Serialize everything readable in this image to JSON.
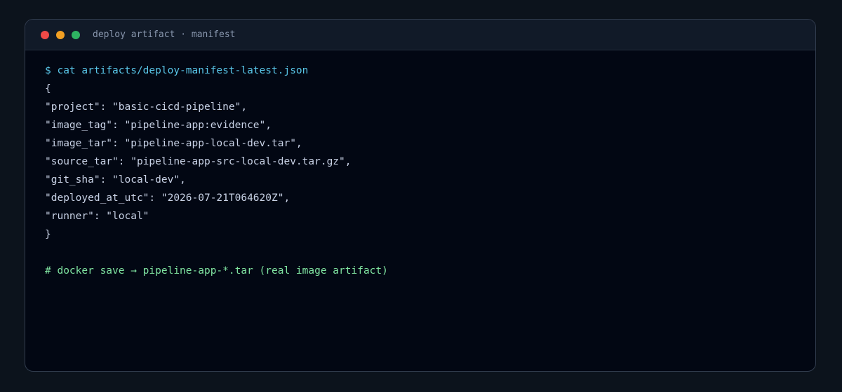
{
  "window": {
    "title": "deploy artifact · manifest",
    "controls": [
      {
        "name": "close",
        "color": "#ef4a47"
      },
      {
        "name": "minimize",
        "color": "#f2a023"
      },
      {
        "name": "maximize",
        "color": "#2eb462"
      }
    ]
  },
  "terminal": {
    "command": "$ cat artifacts/deploy-manifest-latest.json",
    "json_lines": [
      "{",
      "\"project\": \"basic-cicd-pipeline\",",
      "\"image_tag\": \"pipeline-app:evidence\",",
      "\"image_tar\": \"pipeline-app-local-dev.tar\",",
      "\"source_tar\": \"pipeline-app-src-local-dev.tar.gz\",",
      "\"git_sha\": \"local-dev\",",
      "\"deployed_at_utc\": \"2026-07-21T064620Z\",",
      "\"runner\": \"local\"",
      "}"
    ],
    "comment": "# docker save → pipeline-app-*.tar (real image artifact)"
  }
}
